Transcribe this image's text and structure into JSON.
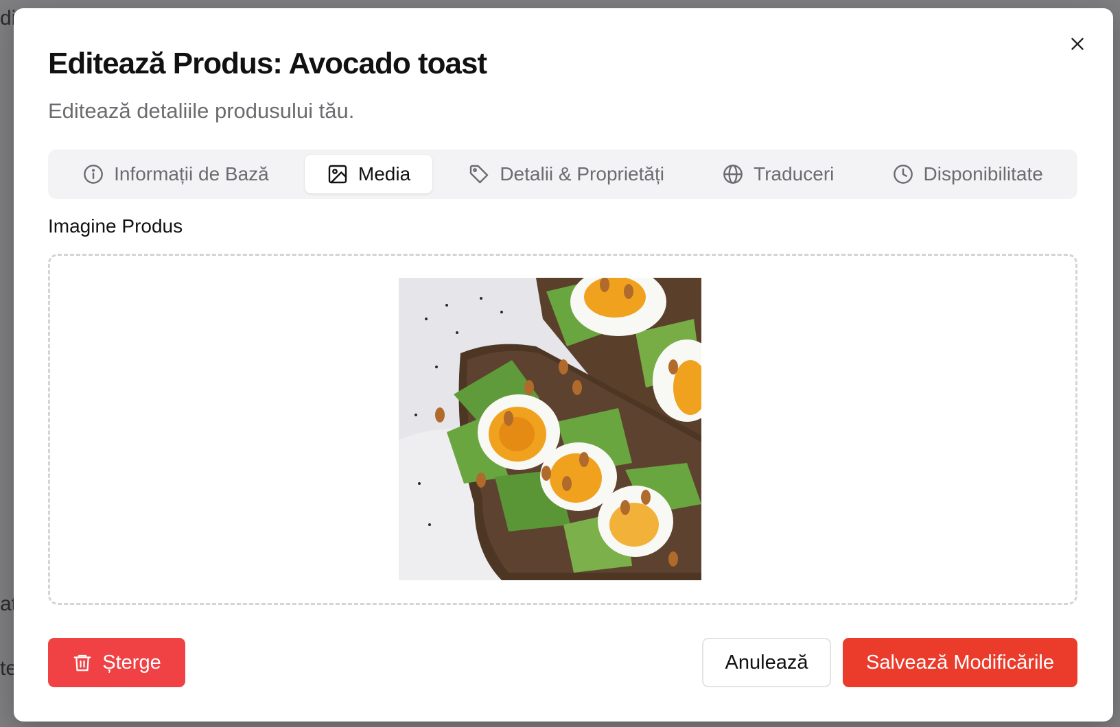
{
  "background": {
    "fragments": [
      "di",
      "at",
      "te"
    ]
  },
  "dialog": {
    "title": "Editează Produs: Avocado toast",
    "subtitle": "Editează detaliile produsului tău.",
    "close_icon": "close-icon"
  },
  "tabs": [
    {
      "label": "Informații de Bază",
      "icon": "info-icon",
      "active": false
    },
    {
      "label": "Media",
      "icon": "image-icon",
      "active": true
    },
    {
      "label": "Detalii & Proprietăți",
      "icon": "tag-icon",
      "active": false
    },
    {
      "label": "Traduceri",
      "icon": "globe-icon",
      "active": false
    },
    {
      "label": "Disponibilitate",
      "icon": "clock-icon",
      "active": false
    }
  ],
  "media": {
    "section_label": "Imagine Produs",
    "image_alt": "Avocado toast"
  },
  "footer": {
    "delete_label": "Șterge",
    "cancel_label": "Anulează",
    "save_label": "Salvează Modificările"
  },
  "colors": {
    "delete": "#f04245",
    "save": "#ea3b2b",
    "active_tab_bg": "#ffffff",
    "tabs_bg": "#f3f3f5"
  }
}
